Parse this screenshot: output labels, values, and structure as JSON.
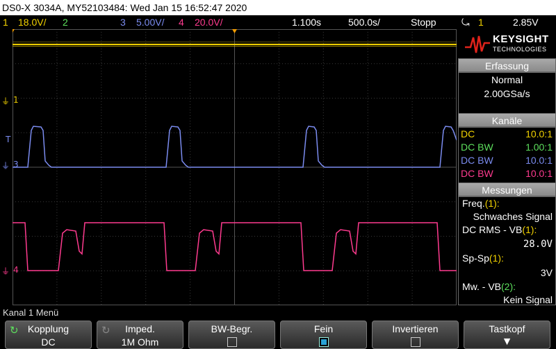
{
  "titlebar": {
    "text": "DS0-X 3034A, MY52103484: Wed Jan 15 16:52:47 2020"
  },
  "channels_bar": {
    "ch1_num": "1",
    "ch1_scale": "18.0V/",
    "ch2_num": "2",
    "ch3_num": "3",
    "ch3_scale": "5.00V/",
    "ch4_num": "4",
    "ch4_scale": "20.0V/",
    "time_delay": "1.100s",
    "time_scale": "500.0s/",
    "run_state": "Stopp",
    "trigger_src": "1",
    "trigger_level": "2.85V"
  },
  "markers": {
    "ch1": "1",
    "ch3": "3",
    "ch4": "4"
  },
  "logo": {
    "brand": "KEYSIGHT",
    "sub": "TECHNOLOGIES"
  },
  "panel": {
    "erfassung": {
      "title": "Erfassung",
      "mode": "Normal",
      "rate": "2.00GSa/s"
    },
    "kanaele": {
      "title": "Kanäle",
      "rows": [
        {
          "coupling": "DC",
          "probe": "10.0:1"
        },
        {
          "coupling": "DC BW",
          "probe": "1.00:1"
        },
        {
          "coupling": "DC BW",
          "probe": "10.0:1"
        },
        {
          "coupling": "DC BW",
          "probe": "10.0:1"
        }
      ]
    },
    "messungen": {
      "title": "Messungen",
      "m1_label": "Freq.",
      "m1_src": "(1):",
      "m1_value": "Schwaches Signal",
      "m2_label": "DC RMS - VB",
      "m2_src": "(1):",
      "m2_value": "28.0V",
      "m3_label": "Sp-Sp",
      "m3_src": "(1):",
      "m3_value": "3V",
      "m4_label": "Mw. - VB",
      "m4_src": "(2):",
      "m4_value": "Kein Signal"
    }
  },
  "menu": {
    "title": "Kanal 1 Menü",
    "softkeys": [
      {
        "label": "Kopplung",
        "value": "DC"
      },
      {
        "label": "Imped.",
        "value": "1M Ohm"
      },
      {
        "label": "BW-Begr.",
        "checked": false
      },
      {
        "label": "Fein",
        "checked": true
      },
      {
        "label": "Invertieren",
        "checked": false
      },
      {
        "label": "Tastkopf"
      }
    ]
  },
  "colors": {
    "ch1": "#f2d200",
    "ch2": "#5de05d",
    "ch3": "#7b8cf0",
    "ch4": "#ff3b8f"
  }
}
